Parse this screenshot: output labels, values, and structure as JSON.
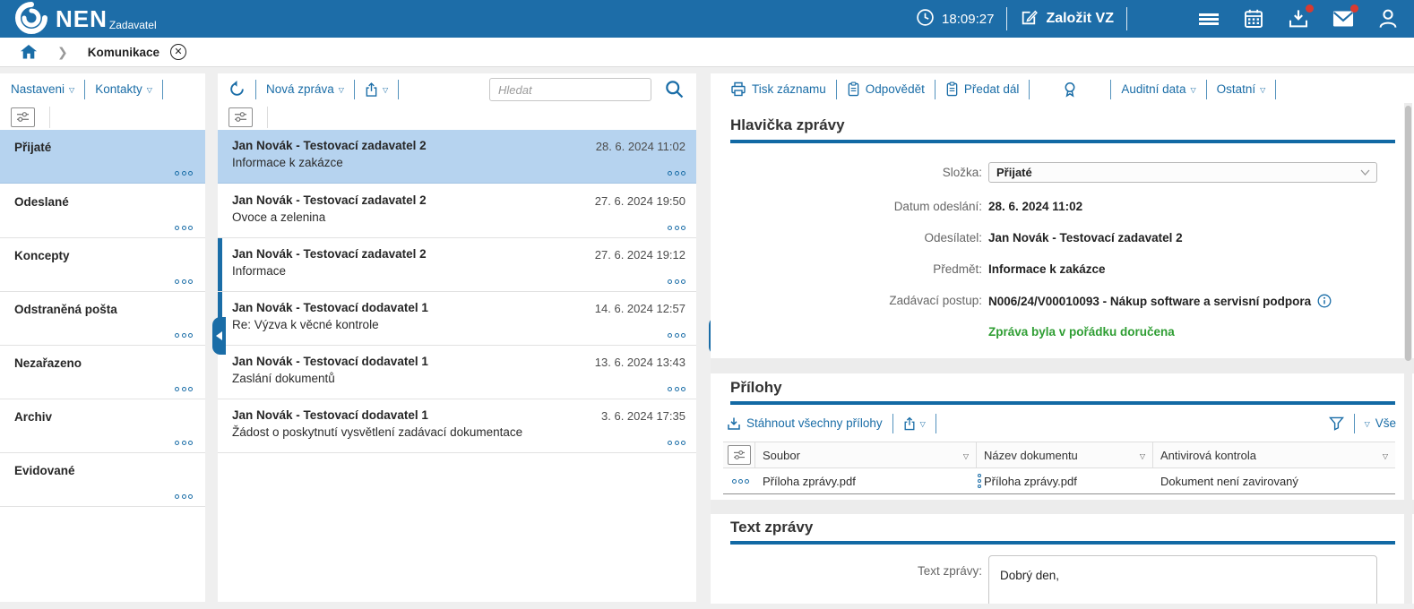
{
  "topbar": {
    "brand": "NEN",
    "role": "Zadavatel",
    "time": "18:09:27",
    "create_label": "Založit VZ"
  },
  "breadcrumb": {
    "page": "Komunikace"
  },
  "left_panel": {
    "menu": [
      {
        "label": "Nastaveni"
      },
      {
        "label": "Kontakty"
      }
    ],
    "folders": [
      {
        "label": "Přijaté",
        "selected": true
      },
      {
        "label": "Odeslané",
        "selected": false
      },
      {
        "label": "Koncepty",
        "selected": false
      },
      {
        "label": "Odstraněná pošta",
        "selected": false
      },
      {
        "label": "Nezařazeno",
        "selected": false
      },
      {
        "label": "Archiv",
        "selected": false
      },
      {
        "label": "Evidované",
        "selected": false
      }
    ]
  },
  "message_list": {
    "new_message_label": "Nová zpráva",
    "search_placeholder": "Hledat",
    "messages": [
      {
        "sender": "Jan Novák - Testovací zadavatel 2",
        "subject": "Informace k zakázce",
        "date": "28. 6. 2024 11:02",
        "selected": true,
        "unread": false
      },
      {
        "sender": "Jan Novák - Testovací zadavatel 2",
        "subject": "Ovoce a zelenina",
        "date": "27. 6. 2024 19:50",
        "selected": false,
        "unread": false
      },
      {
        "sender": "Jan Novák - Testovací zadavatel 2",
        "subject": "Informace",
        "date": "27. 6. 2024 19:12",
        "selected": false,
        "unread": true
      },
      {
        "sender": "Jan Novák - Testovací dodavatel 1",
        "subject": "Re: Výzva k věcné kontrole",
        "date": "14. 6. 2024 12:57",
        "selected": false,
        "unread": true
      },
      {
        "sender": "Jan Novák - Testovací dodavatel 1",
        "subject": "Zaslání dokumentů",
        "date": "13. 6. 2024 13:43",
        "selected": false,
        "unread": false
      },
      {
        "sender": "Jan Novák - Testovací dodavatel 1",
        "subject": "Žádost o poskytnutí vysvětlení zadávací dokumentace",
        "date": "3. 6. 2024 17:35",
        "selected": false,
        "unread": false
      }
    ]
  },
  "detail": {
    "toolbar": {
      "print": "Tisk záznamu",
      "reply": "Odpovědět",
      "forward": "Předat dál",
      "audit": "Auditní data",
      "other": "Ostatní"
    },
    "header_section": {
      "title": "Hlavička zprávy",
      "folder_label": "Složka:",
      "folder_value": "Přijaté",
      "sent_label": "Datum odeslání:",
      "sent_value": "28. 6. 2024 11:02",
      "sender_label": "Odesílatel:",
      "sender_value": "Jan Novák - Testovací zadavatel 2",
      "subject_label": "Předmět:",
      "subject_value": "Informace k zakázce",
      "procedure_label": "Zadávací postup:",
      "procedure_value": "N006/24/V00010093 - Nákup software a servisní podpora",
      "status": "Zpráva byla v pořádku doručena"
    },
    "attachments_section": {
      "title": "Přílohy",
      "download_all_label": "Stáhnout všechny přílohy",
      "filter_all_label": "Vše",
      "columns": {
        "file": "Soubor",
        "doc_name": "Název dokumentu",
        "antivirus": "Antivirová kontrola"
      },
      "rows": [
        {
          "file": "Příloha zprávy.pdf",
          "doc_name": "Příloha zprávy.pdf",
          "antivirus": "Dokument není zavirovaný"
        }
      ]
    },
    "text_section": {
      "title": "Text zprávy",
      "label": "Text zprávy:",
      "value": "Dobrý den,"
    }
  },
  "colors": {
    "topbar_blue": "#1d6da8",
    "link_blue": "#1a6da7",
    "selected_row": "#b6d3ef",
    "status_green": "#2f9e33",
    "badge_red": "#d93a30",
    "section_rule": "#1269a4"
  }
}
